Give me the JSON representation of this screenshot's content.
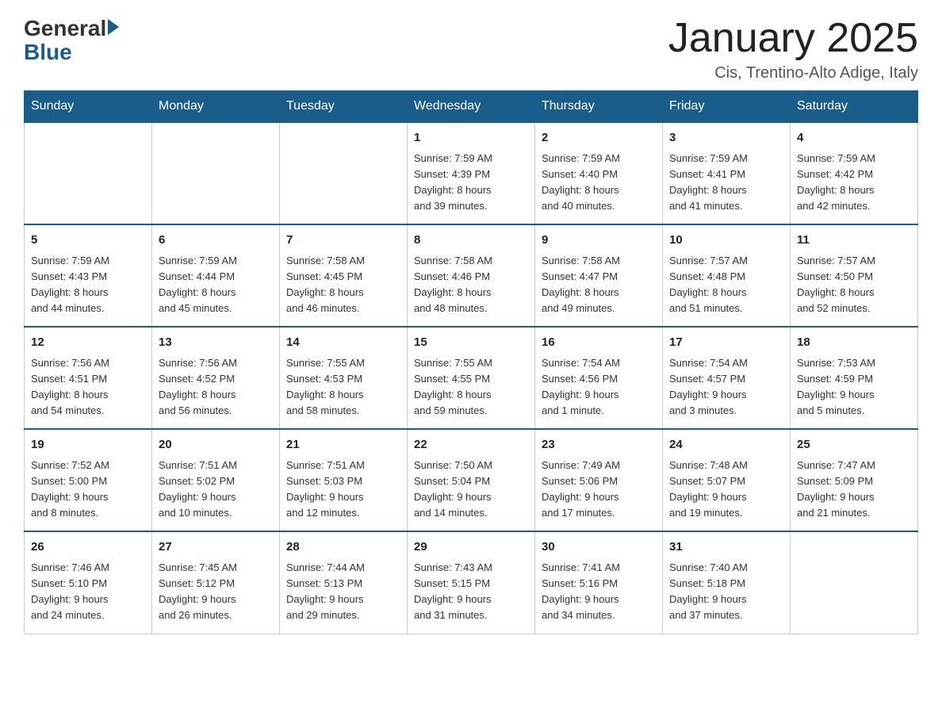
{
  "logo": {
    "general": "General",
    "blue": "Blue"
  },
  "title": "January 2025",
  "subtitle": "Cis, Trentino-Alto Adige, Italy",
  "days_of_week": [
    "Sunday",
    "Monday",
    "Tuesday",
    "Wednesday",
    "Thursday",
    "Friday",
    "Saturday"
  ],
  "weeks": [
    [
      {
        "day": "",
        "info": ""
      },
      {
        "day": "",
        "info": ""
      },
      {
        "day": "",
        "info": ""
      },
      {
        "day": "1",
        "info": "Sunrise: 7:59 AM\nSunset: 4:39 PM\nDaylight: 8 hours\nand 39 minutes."
      },
      {
        "day": "2",
        "info": "Sunrise: 7:59 AM\nSunset: 4:40 PM\nDaylight: 8 hours\nand 40 minutes."
      },
      {
        "day": "3",
        "info": "Sunrise: 7:59 AM\nSunset: 4:41 PM\nDaylight: 8 hours\nand 41 minutes."
      },
      {
        "day": "4",
        "info": "Sunrise: 7:59 AM\nSunset: 4:42 PM\nDaylight: 8 hours\nand 42 minutes."
      }
    ],
    [
      {
        "day": "5",
        "info": "Sunrise: 7:59 AM\nSunset: 4:43 PM\nDaylight: 8 hours\nand 44 minutes."
      },
      {
        "day": "6",
        "info": "Sunrise: 7:59 AM\nSunset: 4:44 PM\nDaylight: 8 hours\nand 45 minutes."
      },
      {
        "day": "7",
        "info": "Sunrise: 7:58 AM\nSunset: 4:45 PM\nDaylight: 8 hours\nand 46 minutes."
      },
      {
        "day": "8",
        "info": "Sunrise: 7:58 AM\nSunset: 4:46 PM\nDaylight: 8 hours\nand 48 minutes."
      },
      {
        "day": "9",
        "info": "Sunrise: 7:58 AM\nSunset: 4:47 PM\nDaylight: 8 hours\nand 49 minutes."
      },
      {
        "day": "10",
        "info": "Sunrise: 7:57 AM\nSunset: 4:48 PM\nDaylight: 8 hours\nand 51 minutes."
      },
      {
        "day": "11",
        "info": "Sunrise: 7:57 AM\nSunset: 4:50 PM\nDaylight: 8 hours\nand 52 minutes."
      }
    ],
    [
      {
        "day": "12",
        "info": "Sunrise: 7:56 AM\nSunset: 4:51 PM\nDaylight: 8 hours\nand 54 minutes."
      },
      {
        "day": "13",
        "info": "Sunrise: 7:56 AM\nSunset: 4:52 PM\nDaylight: 8 hours\nand 56 minutes."
      },
      {
        "day": "14",
        "info": "Sunrise: 7:55 AM\nSunset: 4:53 PM\nDaylight: 8 hours\nand 58 minutes."
      },
      {
        "day": "15",
        "info": "Sunrise: 7:55 AM\nSunset: 4:55 PM\nDaylight: 8 hours\nand 59 minutes."
      },
      {
        "day": "16",
        "info": "Sunrise: 7:54 AM\nSunset: 4:56 PM\nDaylight: 9 hours\nand 1 minute."
      },
      {
        "day": "17",
        "info": "Sunrise: 7:54 AM\nSunset: 4:57 PM\nDaylight: 9 hours\nand 3 minutes."
      },
      {
        "day": "18",
        "info": "Sunrise: 7:53 AM\nSunset: 4:59 PM\nDaylight: 9 hours\nand 5 minutes."
      }
    ],
    [
      {
        "day": "19",
        "info": "Sunrise: 7:52 AM\nSunset: 5:00 PM\nDaylight: 9 hours\nand 8 minutes."
      },
      {
        "day": "20",
        "info": "Sunrise: 7:51 AM\nSunset: 5:02 PM\nDaylight: 9 hours\nand 10 minutes."
      },
      {
        "day": "21",
        "info": "Sunrise: 7:51 AM\nSunset: 5:03 PM\nDaylight: 9 hours\nand 12 minutes."
      },
      {
        "day": "22",
        "info": "Sunrise: 7:50 AM\nSunset: 5:04 PM\nDaylight: 9 hours\nand 14 minutes."
      },
      {
        "day": "23",
        "info": "Sunrise: 7:49 AM\nSunset: 5:06 PM\nDaylight: 9 hours\nand 17 minutes."
      },
      {
        "day": "24",
        "info": "Sunrise: 7:48 AM\nSunset: 5:07 PM\nDaylight: 9 hours\nand 19 minutes."
      },
      {
        "day": "25",
        "info": "Sunrise: 7:47 AM\nSunset: 5:09 PM\nDaylight: 9 hours\nand 21 minutes."
      }
    ],
    [
      {
        "day": "26",
        "info": "Sunrise: 7:46 AM\nSunset: 5:10 PM\nDaylight: 9 hours\nand 24 minutes."
      },
      {
        "day": "27",
        "info": "Sunrise: 7:45 AM\nSunset: 5:12 PM\nDaylight: 9 hours\nand 26 minutes."
      },
      {
        "day": "28",
        "info": "Sunrise: 7:44 AM\nSunset: 5:13 PM\nDaylight: 9 hours\nand 29 minutes."
      },
      {
        "day": "29",
        "info": "Sunrise: 7:43 AM\nSunset: 5:15 PM\nDaylight: 9 hours\nand 31 minutes."
      },
      {
        "day": "30",
        "info": "Sunrise: 7:41 AM\nSunset: 5:16 PM\nDaylight: 9 hours\nand 34 minutes."
      },
      {
        "day": "31",
        "info": "Sunrise: 7:40 AM\nSunset: 5:18 PM\nDaylight: 9 hours\nand 37 minutes."
      },
      {
        "day": "",
        "info": ""
      }
    ]
  ]
}
